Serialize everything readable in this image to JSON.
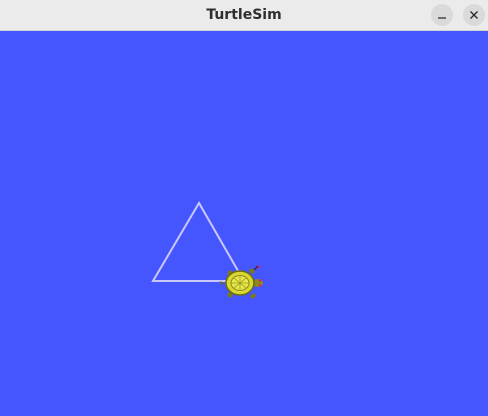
{
  "window": {
    "title": "TurtleSim"
  },
  "colors": {
    "background": "#4556ff",
    "pen": "#c8c8ff",
    "titlebar": "#ebebeb"
  },
  "icons": {
    "minimize": "minimize-icon",
    "close": "close-icon",
    "turtle": "turtle-icon"
  }
}
